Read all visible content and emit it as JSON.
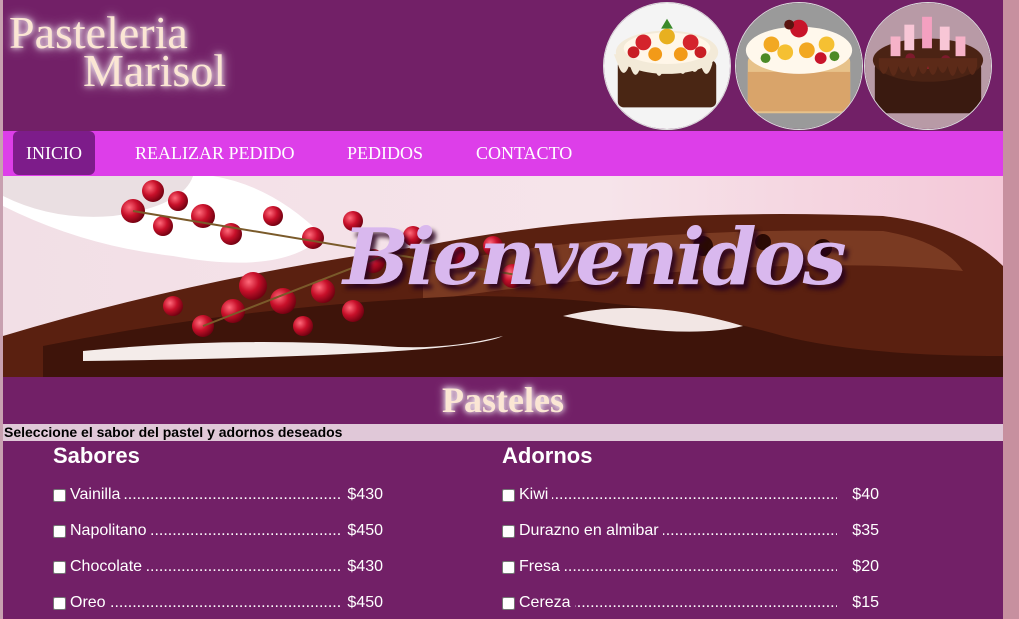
{
  "brand": {
    "line1": "Pasteleria",
    "line2": "Marisol"
  },
  "header_images": [
    {
      "name": "cake-fruit-chocolate-image"
    },
    {
      "name": "cake-fruit-cream-image"
    },
    {
      "name": "cake-berry-chocolate-image"
    }
  ],
  "nav": {
    "items": [
      {
        "label": "INICIO",
        "active": true
      },
      {
        "label": "REALIZAR PEDIDO",
        "active": false
      },
      {
        "label": "PEDIDOS",
        "active": false
      },
      {
        "label": "CONTACTO",
        "active": false
      }
    ]
  },
  "banner": {
    "title": "Bienvenidos"
  },
  "section": {
    "title": "Pasteles",
    "instruction": "Seleccione el sabor del pastel y adornos deseados"
  },
  "sabores": {
    "heading": "Sabores",
    "items": [
      {
        "name": "Vainilla",
        "price": "$430"
      },
      {
        "name": "Napolitano",
        "price": "$450"
      },
      {
        "name": "Chocolate",
        "price": "$430"
      },
      {
        "name": "Oreo",
        "price": "$450"
      }
    ]
  },
  "adornos": {
    "heading": "Adornos",
    "items": [
      {
        "name": "Kiwi",
        "price": "$40"
      },
      {
        "name": "Durazno en almibar",
        "price": "$35"
      },
      {
        "name": "Fresa",
        "price": "$20"
      },
      {
        "name": "Cereza",
        "price": "$15"
      }
    ]
  },
  "colors": {
    "page_bg": "#722067",
    "nav_bg": "#dd3ee9",
    "nav_active": "#7d1c8a",
    "instruction_bg": "#e0c8d8"
  }
}
